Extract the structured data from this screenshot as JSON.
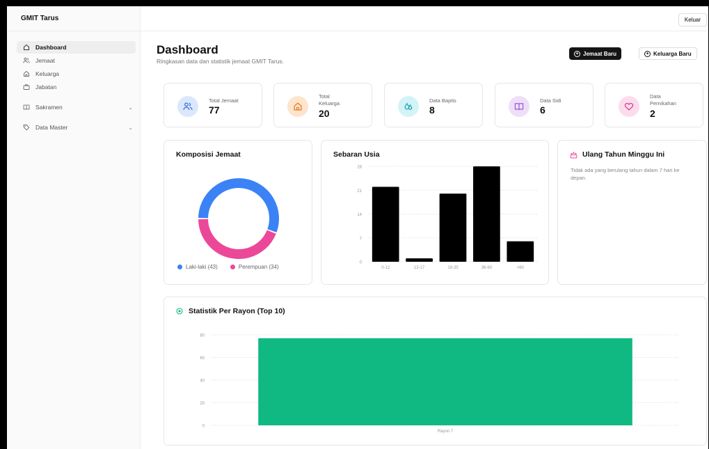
{
  "app": {
    "name": "GMIT Tarus",
    "logout_label": "Keluar"
  },
  "sidebar": {
    "items": [
      {
        "label": "Dashboard",
        "icon": "home-icon",
        "active": true
      },
      {
        "label": "Jemaat",
        "icon": "users-icon"
      },
      {
        "label": "Keluarga",
        "icon": "house-icon"
      },
      {
        "label": "Jabatan",
        "icon": "briefcase-icon"
      },
      {
        "label": "Sakramen",
        "icon": "book-icon",
        "expandable": true
      },
      {
        "label": "Data Master",
        "icon": "tag-icon",
        "expandable": true
      }
    ]
  },
  "header": {
    "title": "Dashboard",
    "subtitle": "Ringkasan data dan statistik jemaat GMIT Tarus.",
    "btn_new_member": "Jemaat Baru",
    "btn_new_family": "Keluarga Baru"
  },
  "stats": [
    {
      "label": "Total Jemaat",
      "value": "77",
      "icon": "users-icon",
      "bg": "#dbe7fb",
      "fg": "#3b6fd6"
    },
    {
      "label": "Total Keluarga",
      "value": "20",
      "icon": "house-icon",
      "bg": "#fde4cc",
      "fg": "#e07a1f"
    },
    {
      "label": "Data Baptis",
      "value": "8",
      "icon": "droplets-icon",
      "bg": "#d4f3f6",
      "fg": "#1aa4b5"
    },
    {
      "label": "Data Sidi",
      "value": "6",
      "icon": "book-open-icon",
      "bg": "#eedff9",
      "fg": "#9b48d6"
    },
    {
      "label": "Data Pernikahan",
      "value": "2",
      "icon": "heart-icon",
      "bg": "#fbdcec",
      "fg": "#d93a8b"
    }
  ],
  "composition": {
    "title": "Komposisi Jemaat",
    "legend_male": "Laki-laki (43)",
    "legend_female": "Perempuan (34)",
    "color_male": "#3b82f6",
    "color_female": "#ec4899"
  },
  "birthdays": {
    "title": "Ulang Tahun Minggu Ini",
    "empty_text": "Tidak ada yang berulang tahun dalam 7 hari ke depan.",
    "accent": "#ec4899"
  },
  "chart_data": [
    {
      "type": "pie",
      "title": "Komposisi Jemaat",
      "categories": [
        "Laki-laki",
        "Perempuan"
      ],
      "values": [
        43,
        34
      ],
      "colors": [
        "#3b82f6",
        "#ec4899"
      ],
      "legend": "bottom"
    },
    {
      "type": "bar",
      "title": "Sebaran Usia",
      "categories": [
        "0-12",
        "13-17",
        "18-35",
        "36-60",
        ">60"
      ],
      "values": [
        22,
        1,
        20,
        28,
        6
      ],
      "ylim": [
        0,
        28
      ],
      "yticks": [
        "0",
        "7",
        "14",
        "21",
        "28"
      ],
      "color": "#000000",
      "grid": true
    },
    {
      "type": "bar",
      "title": "Statistik Per Rayon (Top 10)",
      "categories": [
        "Rayon 7"
      ],
      "values": [
        77
      ],
      "ylim": [
        0,
        80
      ],
      "yticks": [
        "0",
        "20",
        "40",
        "60",
        "80"
      ],
      "color": "#10b981",
      "grid": true
    }
  ]
}
